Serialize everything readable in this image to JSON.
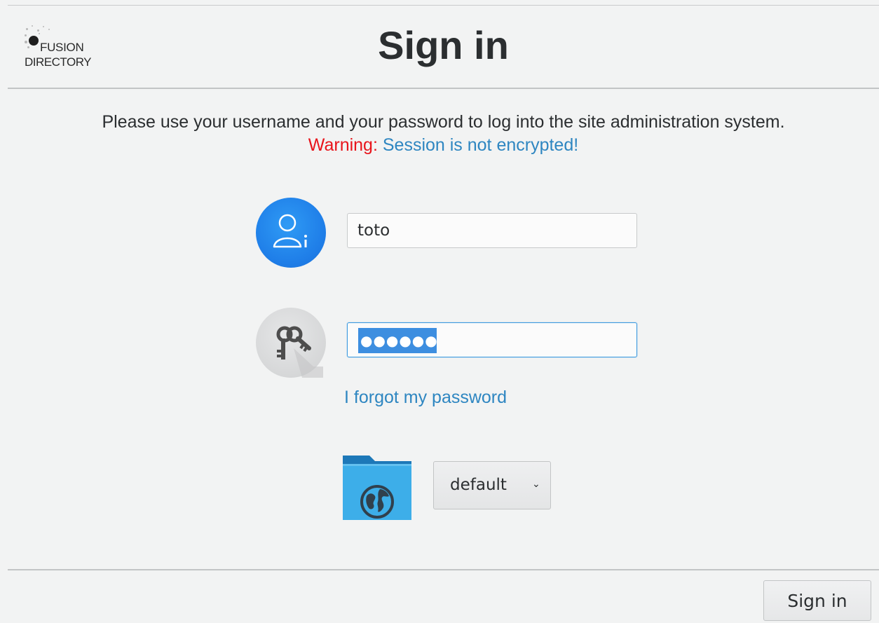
{
  "header": {
    "logo_line1": "FUSION",
    "logo_line2": "DIRECTORY",
    "title": "Sign in"
  },
  "message": {
    "intro": "Please use your username and your password to log into the site administration system.",
    "warning_label": "Warning:",
    "warning_text": "Session is not encrypted!"
  },
  "form": {
    "username_icon": "user-icon",
    "username_value": "toto",
    "password_icon": "keys-icon",
    "password_mask": "●●●●●●",
    "forgot_link": "I forgot my password",
    "directory_icon": "folder-globe-icon",
    "directory_selected": "default"
  },
  "footer": {
    "signin_button": "Sign in"
  },
  "colors": {
    "warning_red": "#e8141b",
    "link_blue": "#2e86c1",
    "user_icon_blue": "#1f7ee8",
    "selection_blue": "#3d8ee0",
    "folder_blue": "#3daee9"
  }
}
